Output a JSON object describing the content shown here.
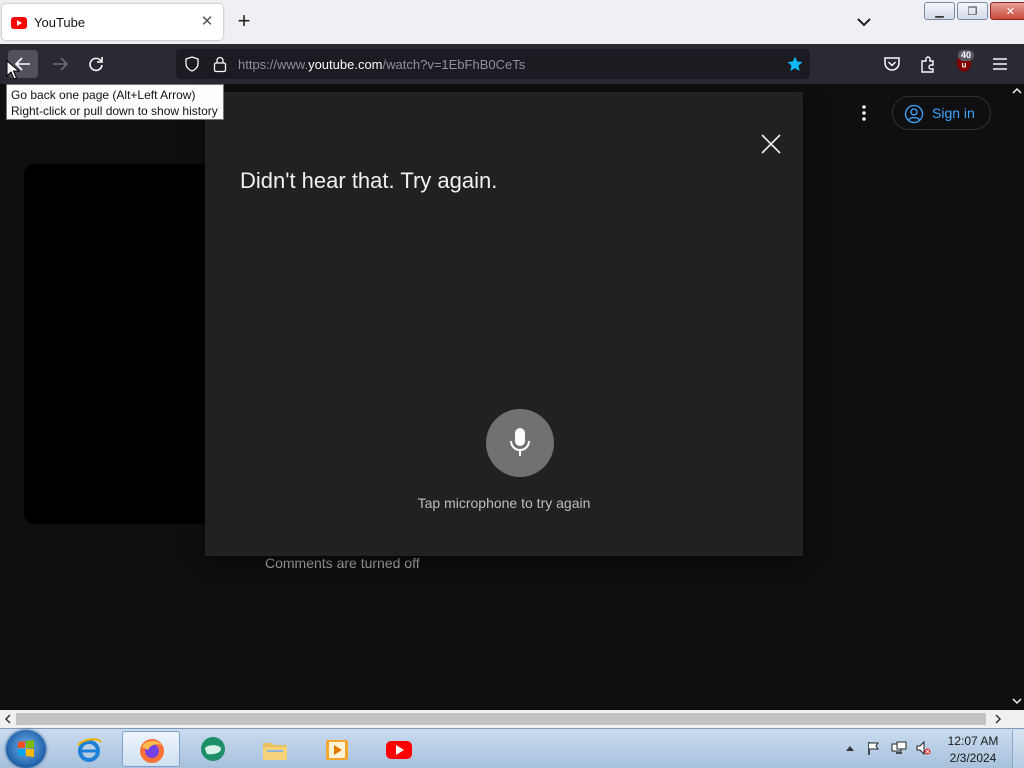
{
  "browser": {
    "tab": {
      "title": "YouTube",
      "close_symbol": "✕"
    },
    "new_tab_symbol": "+",
    "window_buttons": {
      "minimize": "▁",
      "maximize": "❐",
      "close": "✕"
    },
    "url": {
      "prefix": "https://www.",
      "host": "youtube.com",
      "path": "/watch?v=1EbFhB0CeTs"
    },
    "extension_badge": "40",
    "tooltip": {
      "line1": "Go back one page (Alt+Left Arrow)",
      "line2": "Right-click or pull down to show history"
    }
  },
  "youtube": {
    "sign_in_label": "Sign in",
    "comments_status": "Comments are turned off",
    "voice_dialog": {
      "message": "Didn't hear that. Try again.",
      "hint": "Tap microphone to try again"
    }
  },
  "taskbar": {
    "items": [
      "internet-explorer",
      "firefox",
      "unknown-app",
      "file-explorer",
      "media-player",
      "youtube"
    ],
    "active_item": "firefox",
    "clock": {
      "time": "12:07 AM",
      "date": "2/3/2024"
    }
  },
  "colors": {
    "page_background": "#0f0f0f",
    "dialog_background": "#212121",
    "link_blue": "#3ea6ff",
    "browser_toolbar": "#2b2a33",
    "bookmark_star": "#0db9f9"
  }
}
